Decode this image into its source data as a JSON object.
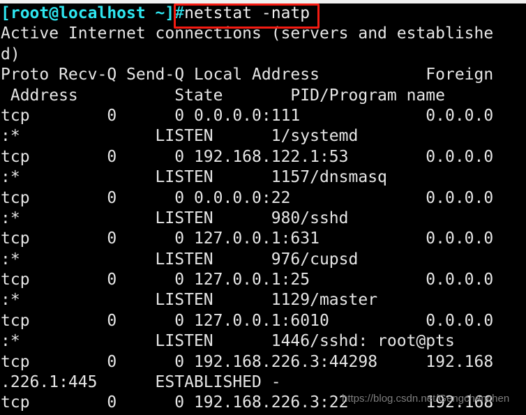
{
  "terminal": {
    "prompt": {
      "user_host_path": "[root@localhost ~]",
      "hash": "#",
      "command": "netstat -natp",
      "full_line": "[root@localhost ~]#netstat -natp"
    },
    "highlight": {
      "color": "#f41b12",
      "target": "#netstat -natp"
    },
    "colors": {
      "background": "#000000",
      "foreground": "#e6e6e6",
      "prompt": "#2ee6f0",
      "highlight_box": "#f41b12",
      "watermark": "#7e7e7e",
      "top_strip": "#f0f0f0"
    },
    "banner": "Active Internet connections (servers and established)",
    "wrapped_lines": [
      "Active Internet connections (servers and establishe",
      "d)",
      "Proto Recv-Q Send-Q Local Address           Foreign",
      " Address          State       PID/Program name",
      "tcp        0      0 0.0.0.0:111             0.0.0.0",
      ":*              LISTEN      1/systemd",
      "tcp        0      0 192.168.122.1:53        0.0.0.0",
      ":*              LISTEN      1157/dnsmasq",
      "tcp        0      0 0.0.0.0:22              0.0.0.0",
      ":*              LISTEN      980/sshd",
      "tcp        0      0 127.0.0.1:631           0.0.0.0",
      ":*              LISTEN      976/cupsd",
      "tcp        0      0 127.0.0.1:25            0.0.0.0",
      ":*              LISTEN      1129/master",
      "tcp        0      0 127.0.0.1:6010          0.0.0.0",
      ":*              LISTEN      1446/sshd: root@pts",
      "tcp        0      0 192.168.226.3:44298     192.168",
      ".226.1:445      ESTABLISHED -",
      "tcp        0      0 192.168.226.3:22        192.168"
    ],
    "headers": [
      "Proto",
      "Recv-Q",
      "Send-Q",
      "Local Address",
      "Foreign Address",
      "State",
      "PID/Program name"
    ],
    "connections": [
      {
        "proto": "tcp",
        "recv_q": "0",
        "send_q": "0",
        "local_address": "0.0.0.0:111",
        "foreign_address": "0.0.0.0:*",
        "state": "LISTEN",
        "pid_program": "1/systemd"
      },
      {
        "proto": "tcp",
        "recv_q": "0",
        "send_q": "0",
        "local_address": "192.168.122.1:53",
        "foreign_address": "0.0.0.0:*",
        "state": "LISTEN",
        "pid_program": "1157/dnsmasq"
      },
      {
        "proto": "tcp",
        "recv_q": "0",
        "send_q": "0",
        "local_address": "0.0.0.0:22",
        "foreign_address": "0.0.0.0:*",
        "state": "LISTEN",
        "pid_program": "980/sshd"
      },
      {
        "proto": "tcp",
        "recv_q": "0",
        "send_q": "0",
        "local_address": "127.0.0.1:631",
        "foreign_address": "0.0.0.0:*",
        "state": "LISTEN",
        "pid_program": "976/cupsd"
      },
      {
        "proto": "tcp",
        "recv_q": "0",
        "send_q": "0",
        "local_address": "127.0.0.1:25",
        "foreign_address": "0.0.0.0:*",
        "state": "LISTEN",
        "pid_program": "1129/master"
      },
      {
        "proto": "tcp",
        "recv_q": "0",
        "send_q": "0",
        "local_address": "127.0.0.1:6010",
        "foreign_address": "0.0.0.0:*",
        "state": "LISTEN",
        "pid_program": "1446/sshd: root@pts"
      },
      {
        "proto": "tcp",
        "recv_q": "0",
        "send_q": "0",
        "local_address": "192.168.226.3:44298",
        "foreign_address": "192.168.226.1:445",
        "state": "ESTABLISHED",
        "pid_program": "-"
      },
      {
        "proto": "tcp",
        "recv_q": "0",
        "send_q": "0",
        "local_address": "192.168.226.3:22",
        "foreign_address": "192.168",
        "state": "",
        "pid_program": ""
      }
    ],
    "watermark": "https://blog.csdn.net/Gengchenchen"
  }
}
